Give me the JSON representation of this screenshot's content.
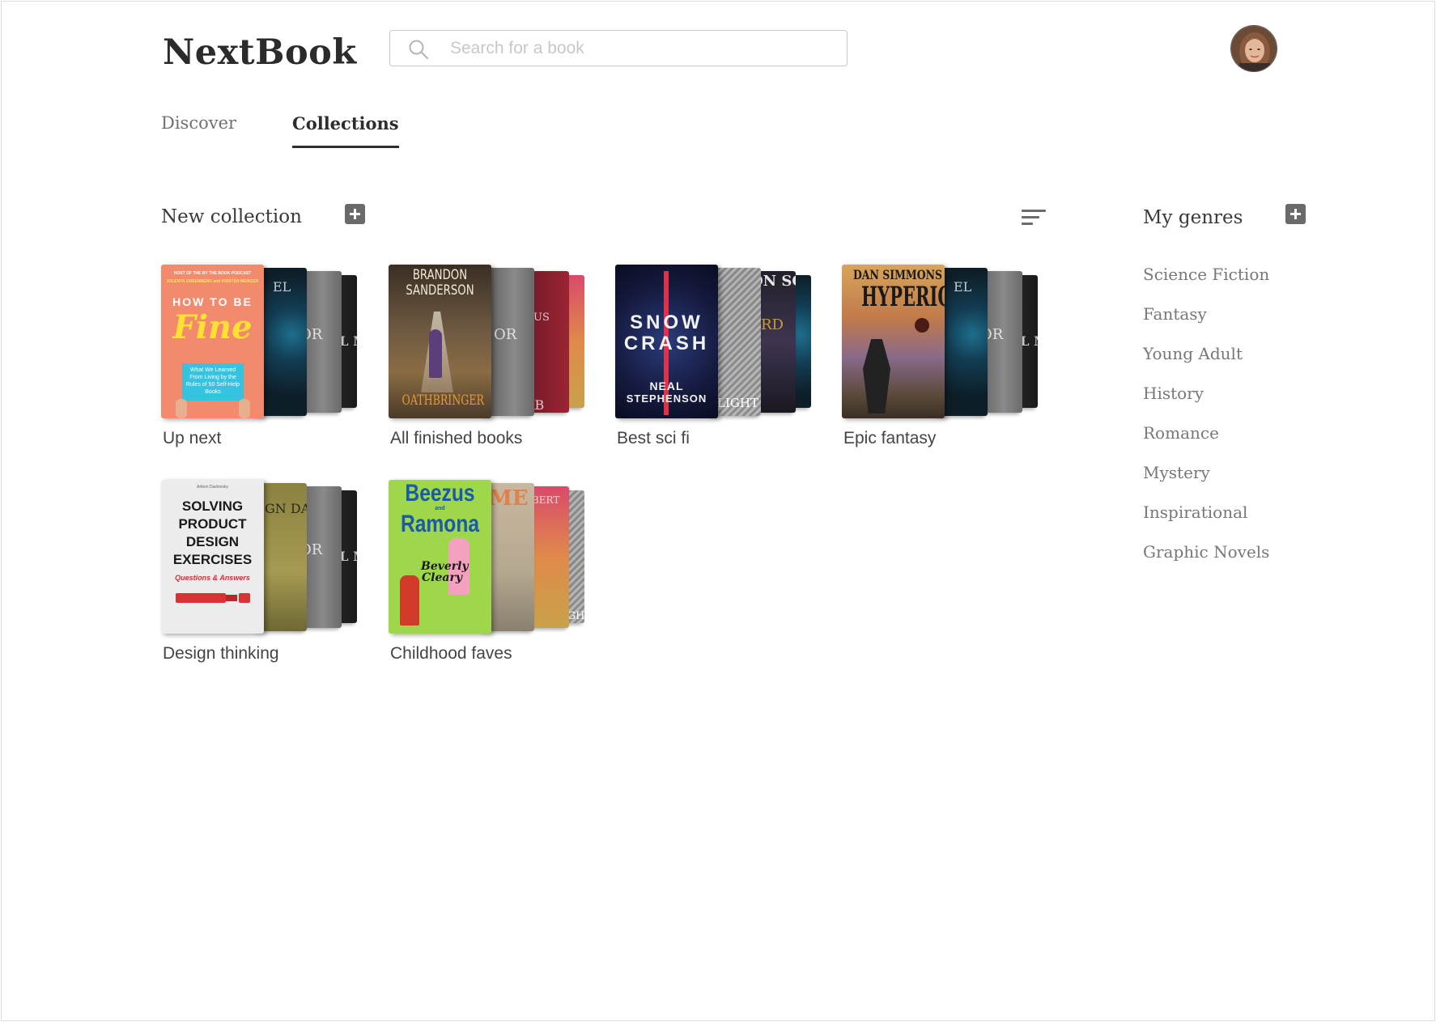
{
  "app": {
    "title": "NextBook"
  },
  "search": {
    "placeholder": "Search for a book"
  },
  "tabs": [
    {
      "label": "Discover",
      "active": false
    },
    {
      "label": "Collections",
      "active": true
    }
  ],
  "collections_header": {
    "title": "New collection"
  },
  "collections": [
    {
      "label": "Up next",
      "cover": {
        "top_line": "HOST OF THE BY THE BOOK PODCAST",
        "authors": "JOLENTA GREENBERG and KRISTEN MEINZER",
        "title_line1": "HOW TO BE",
        "title_line2": "Fine",
        "tagline": "What We Learned From Living by the Rules of 50 Self-Help Books"
      },
      "spines": [
        "EL",
        "OR",
        "LL ME"
      ]
    },
    {
      "label": "All finished books",
      "cover": {
        "author": "BRANDON SANDERSON",
        "title": "OATHBRINGER"
      },
      "spines": [
        "OR",
        "US",
        "AB"
      ]
    },
    {
      "label": "Best sci fi",
      "cover": {
        "title_line1": "SNOW",
        "title_line2": "CRASH",
        "author_line1": "NEAL",
        "author_line2": "STEPHENSON"
      },
      "spines": [
        "LIGHT",
        "ON SON",
        "ARD"
      ]
    },
    {
      "label": "Epic fantasy",
      "cover": {
        "author": "DAN SIMMONS",
        "title": "HYPERION"
      },
      "spines": [
        "EL",
        "OR",
        "LL ME"
      ]
    },
    {
      "label": "Design thinking",
      "cover": {
        "author": "Artiom Dashinsky",
        "title_line1": "SOLVING",
        "title_line2": "PRODUCT",
        "title_line3": "DESIGN",
        "title_line4": "EXERCISES",
        "subtitle": "Questions & Answers"
      },
      "spines": [
        "GN DAY",
        "OR",
        "LL ME"
      ]
    },
    {
      "label": "Childhood faves",
      "cover": {
        "title_line1": "Beezus",
        "title_and": "and",
        "title_line2": "Ramona",
        "author_line1": "Beverly",
        "author_line2": "Cleary"
      },
      "spines": [
        "ME",
        "LBERT",
        "LIGHT"
      ]
    }
  ],
  "genres_header": {
    "title": "My genres"
  },
  "genres": [
    "Science Fiction",
    "Fantasy",
    "Young Adult",
    "History",
    "Romance",
    "Mystery",
    "Inspirational",
    "Graphic Novels"
  ],
  "colors": {
    "accent_dark": "#2d2d2d",
    "muted_text": "#777777",
    "icon_gray": "#6a6a6a"
  }
}
